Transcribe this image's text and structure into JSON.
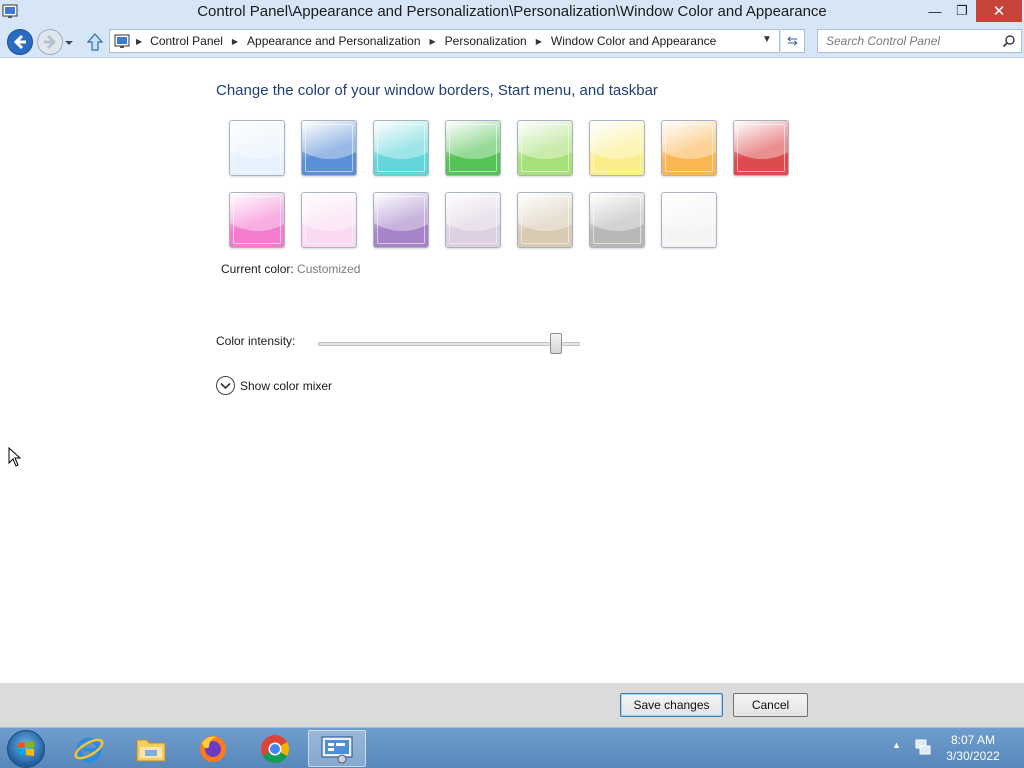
{
  "window": {
    "title": "Control Panel\\Appearance and Personalization\\Personalization\\Window Color and Appearance",
    "minimize_glyph": "—",
    "maximize_glyph": "❐",
    "close_glyph": "✕"
  },
  "navigation": {
    "breadcrumbs": [
      "Control Panel",
      "Appearance and Personalization",
      "Personalization",
      "Window Color and Appearance"
    ],
    "search_placeholder": "Search Control Panel"
  },
  "content": {
    "heading": "Change the color of your window borders, Start menu, and taskbar",
    "swatches": [
      {
        "name": "sky",
        "color": "#e7f1fd"
      },
      {
        "name": "twilight",
        "color": "#5b8fd6"
      },
      {
        "name": "sea-foam",
        "color": "#62d6d8"
      },
      {
        "name": "leaf",
        "color": "#55c256"
      },
      {
        "name": "lime",
        "color": "#a8e07a"
      },
      {
        "name": "lemon",
        "color": "#fbee8a"
      },
      {
        "name": "pumpkin",
        "color": "#fbb654"
      },
      {
        "name": "ruby",
        "color": "#dc4b4d"
      },
      {
        "name": "fuchsia",
        "color": "#f37cce"
      },
      {
        "name": "blush",
        "color": "#fadaf3"
      },
      {
        "name": "violet",
        "color": "#a584c8"
      },
      {
        "name": "lavender",
        "color": "#dcd0e2"
      },
      {
        "name": "taupe",
        "color": "#d7cbb3"
      },
      {
        "name": "chocolate-gray",
        "color": "#b8b8b8"
      },
      {
        "name": "frost",
        "color": "#f3f3f3"
      }
    ],
    "current_color_label": "Current color:",
    "current_color_value": "Customized",
    "intensity_label": "Color intensity:",
    "intensity_level_fraction": 0.91,
    "mixer_label": "Show color mixer"
  },
  "buttons": {
    "save": "Save changes",
    "cancel": "Cancel"
  },
  "taskbar": {
    "items": [
      "internet-explorer",
      "file-explorer",
      "firefox",
      "chrome",
      "control-panel"
    ],
    "clock_time": "8:07 AM",
    "clock_date": "3/30/2022"
  }
}
